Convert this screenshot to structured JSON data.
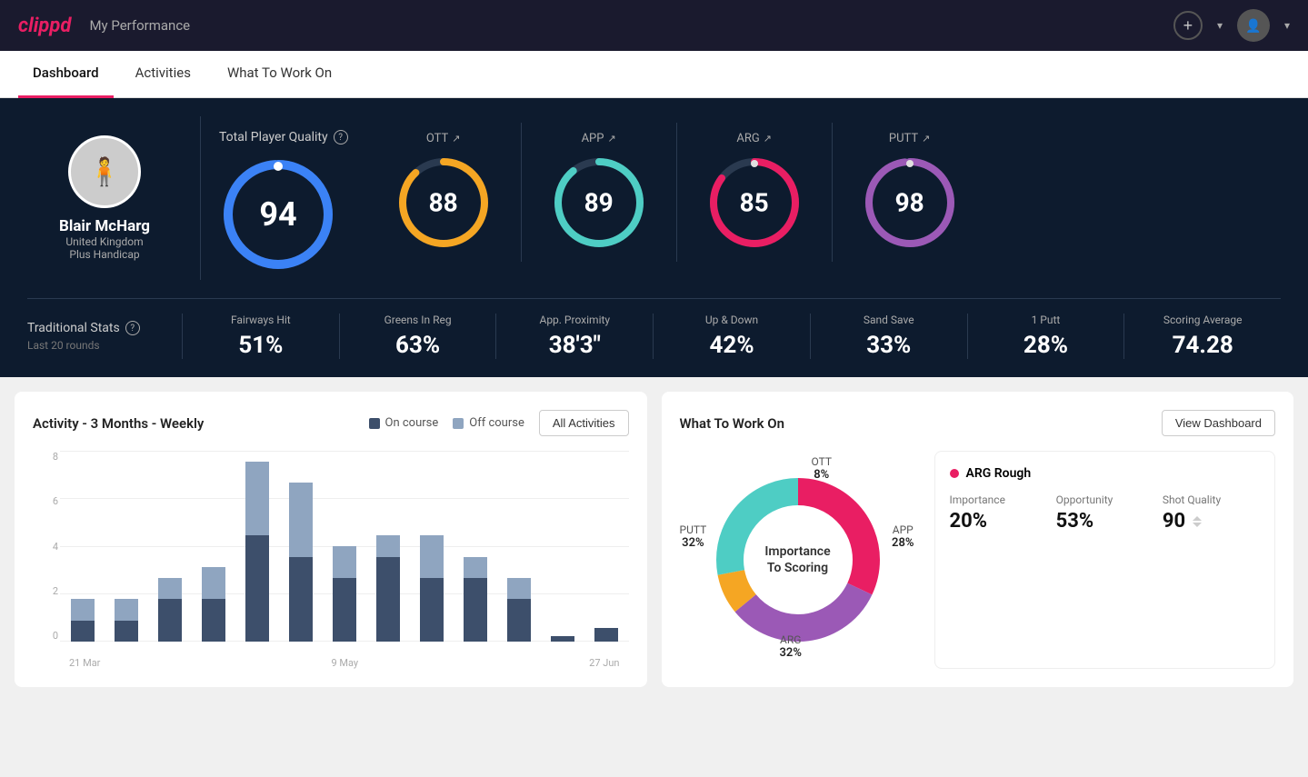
{
  "app": {
    "logo": "clippd",
    "title": "My Performance"
  },
  "nav": {
    "tabs": [
      {
        "id": "dashboard",
        "label": "Dashboard",
        "active": true
      },
      {
        "id": "activities",
        "label": "Activities",
        "active": false
      },
      {
        "id": "what-to-work-on",
        "label": "What To Work On",
        "active": false
      }
    ]
  },
  "player": {
    "name": "Blair McHarg",
    "country": "United Kingdom",
    "handicap": "Plus Handicap"
  },
  "quality": {
    "title": "Total Player Quality",
    "main_score": "94",
    "gauges": [
      {
        "id": "ott",
        "label": "OTT",
        "value": "88",
        "color": "#f5a623",
        "pct": 88
      },
      {
        "id": "app",
        "label": "APP",
        "value": "89",
        "color": "#4ecdc4",
        "pct": 89
      },
      {
        "id": "arg",
        "label": "ARG",
        "value": "85",
        "color": "#e91e63",
        "pct": 85
      },
      {
        "id": "putt",
        "label": "PUTT",
        "value": "98",
        "color": "#9b59b6",
        "pct": 98
      }
    ]
  },
  "trad_stats": {
    "title": "Traditional Stats",
    "subtitle": "Last 20 rounds",
    "items": [
      {
        "label": "Fairways Hit",
        "value": "51%"
      },
      {
        "label": "Greens In Reg",
        "value": "63%"
      },
      {
        "label": "App. Proximity",
        "value": "38'3\""
      },
      {
        "label": "Up & Down",
        "value": "42%"
      },
      {
        "label": "Sand Save",
        "value": "33%"
      },
      {
        "label": "1 Putt",
        "value": "28%"
      },
      {
        "label": "Scoring Average",
        "value": "74.28"
      }
    ]
  },
  "activity_chart": {
    "title": "Activity - 3 Months - Weekly",
    "legend_on": "On course",
    "legend_off": "Off course",
    "all_activities_btn": "All Activities",
    "y_labels": [
      "8",
      "6",
      "4",
      "2",
      "0"
    ],
    "x_labels": [
      "21 Mar",
      "9 May",
      "27 Jun"
    ],
    "bars": [
      {
        "on": 1,
        "off": 1
      },
      {
        "on": 1,
        "off": 1
      },
      {
        "on": 2,
        "off": 1
      },
      {
        "on": 2,
        "off": 1.5
      },
      {
        "on": 5,
        "off": 3.5
      },
      {
        "on": 4,
        "off": 3.5
      },
      {
        "on": 3,
        "off": 1.5
      },
      {
        "on": 4,
        "off": 1
      },
      {
        "on": 3,
        "off": 2
      },
      {
        "on": 3,
        "off": 1
      },
      {
        "on": 2,
        "off": 1
      },
      {
        "on": 0.5,
        "off": 0
      },
      {
        "on": 0.8,
        "off": 0
      }
    ]
  },
  "what_to_work_on": {
    "title": "What To Work On",
    "view_dashboard_btn": "View Dashboard",
    "donut_center": "Importance\nTo Scoring",
    "segments": [
      {
        "label": "OTT",
        "pct": "8%",
        "color": "#f5a623"
      },
      {
        "label": "APP",
        "pct": "28%",
        "color": "#4ecdc4"
      },
      {
        "label": "ARG",
        "pct": "32%",
        "color": "#e91e63"
      },
      {
        "label": "PUTT",
        "pct": "32%",
        "color": "#9b59b6"
      }
    ],
    "detail": {
      "title": "ARG Rough",
      "importance": "20%",
      "opportunity": "53%",
      "shot_quality": "90"
    }
  }
}
